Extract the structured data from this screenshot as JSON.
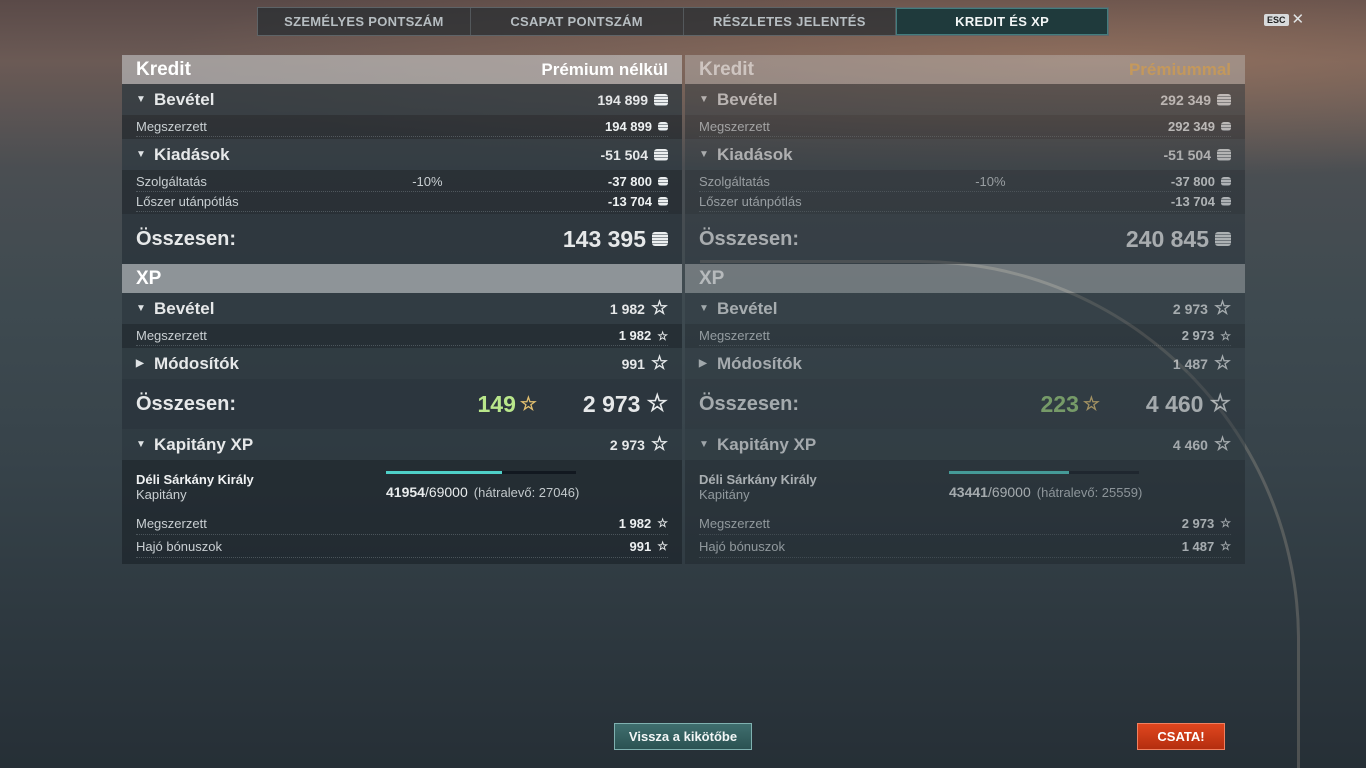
{
  "tabs": [
    "SZEMÉLYES PONTSZÁM",
    "CSAPAT PONTSZÁM",
    "RÉSZLETES JELENTÉS",
    "KREDIT ÉS XP"
  ],
  "active_tab": "KREDIT ÉS XP",
  "esc": {
    "key": "ESC",
    "close": "✕"
  },
  "colors": {
    "accent": "#4fd0c8",
    "premium": "#e8b45c",
    "battle_button": "#c8391a",
    "bonus_xp": "#b9e78b"
  },
  "left": {
    "credit_title": "Kredit",
    "variant": "Prémium nélkül",
    "income": {
      "label": "Bevétel",
      "value": "194 899",
      "rows": [
        {
          "label": "Megszerzett",
          "value": "194 899"
        }
      ]
    },
    "expenses": {
      "label": "Kiadások",
      "value": "-51 504",
      "rows": [
        {
          "label": "Szolgáltatás",
          "modifier": "-10%",
          "value": "-37 800"
        },
        {
          "label": "Lőszer utánpótlás",
          "value": "-13 704"
        }
      ]
    },
    "credit_total": {
      "label": "Összesen:",
      "value": "143 395"
    },
    "xp_title": "XP",
    "xp_income": {
      "label": "Bevétel",
      "value": "1 982",
      "rows": [
        {
          "label": "Megszerzett",
          "value": "1 982"
        }
      ]
    },
    "modifiers": {
      "label": "Módosítók",
      "value": "991"
    },
    "xp_total": {
      "label": "Összesen:",
      "bonus": "149",
      "value": "2 973"
    },
    "captain_xp": {
      "label": "Kapitány XP",
      "value": "2 973"
    },
    "captain": {
      "name": "Déli Sárkány Király",
      "rank": "Kapitány",
      "current": "41954",
      "max": "/69000",
      "remaining": "(hátralevő: 27046)",
      "progress": 0.608,
      "rows": [
        {
          "label": "Megszerzett",
          "value": "1 982"
        },
        {
          "label": "Hajó bónuszok",
          "value": "991"
        }
      ]
    }
  },
  "right": {
    "credit_title": "Kredit",
    "variant": "Prémiummal",
    "income": {
      "label": "Bevétel",
      "value": "292 349",
      "rows": [
        {
          "label": "Megszerzett",
          "value": "292 349"
        }
      ]
    },
    "expenses": {
      "label": "Kiadások",
      "value": "-51 504",
      "rows": [
        {
          "label": "Szolgáltatás",
          "modifier": "-10%",
          "value": "-37 800"
        },
        {
          "label": "Lőszer utánpótlás",
          "value": "-13 704"
        }
      ]
    },
    "credit_total": {
      "label": "Összesen:",
      "value": "240 845"
    },
    "xp_title": "XP",
    "xp_income": {
      "label": "Bevétel",
      "value": "2 973",
      "rows": [
        {
          "label": "Megszerzett",
          "value": "2 973"
        }
      ]
    },
    "modifiers": {
      "label": "Módosítók",
      "value": "1 487"
    },
    "xp_total": {
      "label": "Összesen:",
      "bonus": "223",
      "value": "4 460"
    },
    "captain_xp": {
      "label": "Kapitány XP",
      "value": "4 460"
    },
    "captain": {
      "name": "Déli Sárkány Király",
      "rank": "Kapitány",
      "current": "43441",
      "max": "/69000",
      "remaining": "(hátralevő: 25559)",
      "progress": 0.63,
      "rows": [
        {
          "label": "Megszerzett",
          "value": "2 973"
        },
        {
          "label": "Hajó bónuszok",
          "value": "1 487"
        }
      ]
    }
  },
  "buttons": {
    "back": "Vissza a kikötőbe",
    "battle": "CSATA!"
  }
}
